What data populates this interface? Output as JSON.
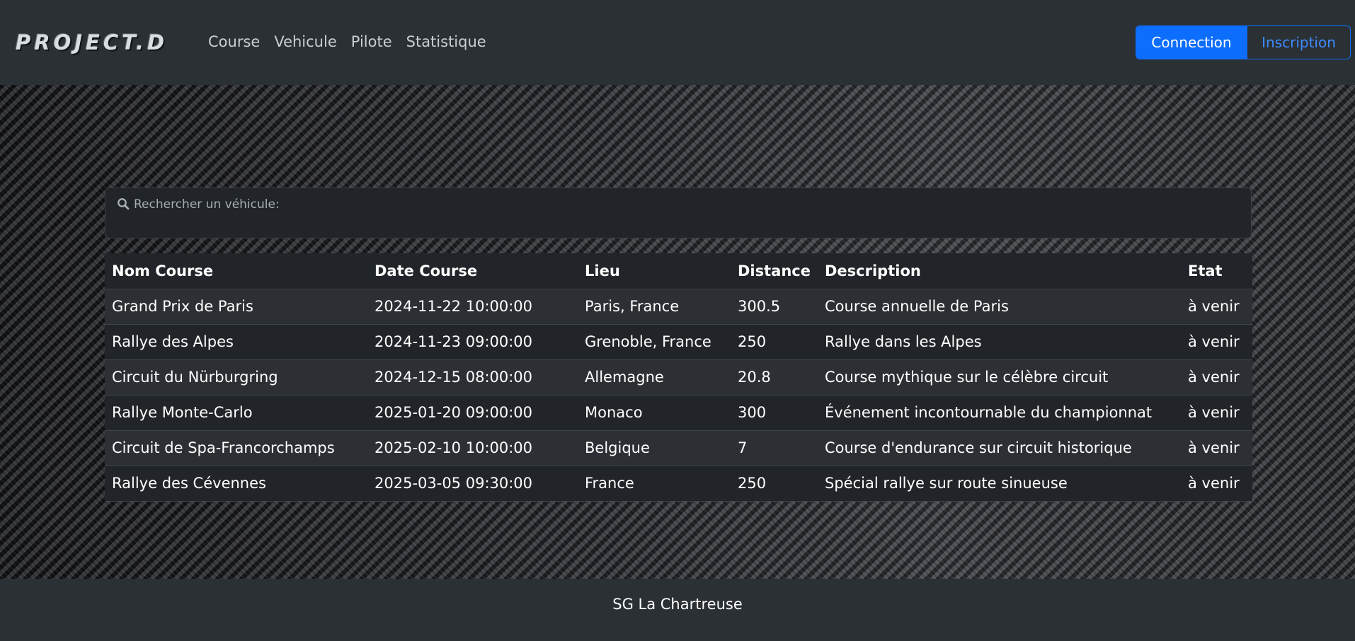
{
  "header": {
    "logo_text": "PROJECT.D",
    "nav": [
      "Course",
      "Vehicule",
      "Pilote",
      "Statistique"
    ],
    "connect_label": "Connection",
    "signup_label": "Inscription"
  },
  "search": {
    "placeholder": "Rechercher un véhicule:"
  },
  "table": {
    "columns": [
      "Nom Course",
      "Date Course",
      "Lieu",
      "Distance",
      "Description",
      "Etat"
    ],
    "rows": [
      [
        "Grand Prix de Paris",
        "2024-11-22 10:00:00",
        "Paris, France",
        "300.5",
        "Course annuelle de Paris",
        "à venir"
      ],
      [
        "Rallye des Alpes",
        "2024-11-23 09:00:00",
        "Grenoble, France",
        "250",
        "Rallye dans les Alpes",
        "à venir"
      ],
      [
        "Circuit du Nürburgring",
        "2024-12-15 08:00:00",
        "Allemagne",
        "20.8",
        "Course mythique sur le célèbre circuit",
        "à venir"
      ],
      [
        "Rallye Monte-Carlo",
        "2025-01-20 09:00:00",
        "Monaco",
        "300",
        "Événement incontournable du championnat",
        "à venir"
      ],
      [
        "Circuit de Spa-Francorchamps",
        "2025-02-10 10:00:00",
        "Belgique",
        "7",
        "Course d'endurance sur circuit historique",
        "à venir"
      ],
      [
        "Rallye des Cévennes",
        "2025-03-05 09:30:00",
        "France",
        "250",
        "Spécial rallye sur route sinueuse",
        "à venir"
      ]
    ]
  },
  "footer": {
    "text": "SG La Chartreuse"
  },
  "colors": {
    "primary": "#0d6efd",
    "navbar_bg": "#2b3035",
    "table_dark": "#212529"
  }
}
